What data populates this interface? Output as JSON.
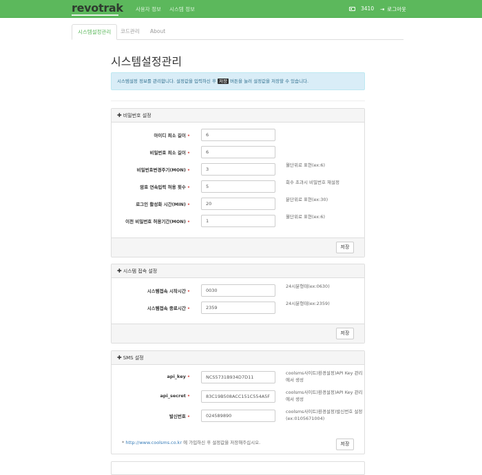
{
  "navbar": {
    "brand": "revotrak",
    "links": [
      "사용자 정보",
      "시스템 정보"
    ],
    "credits": "3410",
    "logout": "로그아웃"
  },
  "tabs": [
    "시스템설정관리",
    "코드관리",
    "About"
  ],
  "page": {
    "title": "시스템설정관리",
    "info_before": "시스템설정 정보를 관리합니다. 설정값을 입력하신 후 ",
    "info_key": "저장",
    "info_after": " 버튼을 눌러 설정값을 저장할 수 있습니다."
  },
  "password_panel": {
    "heading": "비밀번호 설정",
    "fields": [
      {
        "label": "아이디 최소 길이",
        "value": "6",
        "help": ""
      },
      {
        "label": "비밀번호 최소 길이",
        "value": "6",
        "help": ""
      },
      {
        "label": "비밀번호변경주기(MON)",
        "value": "3",
        "help": "월단위로 표현(ex:6)"
      },
      {
        "label": "암호 연속입력 허용 횟수",
        "value": "5",
        "help": "회수 초과시 비밀번호 재설정"
      },
      {
        "label": "로그인 활성화 시간(MIN)",
        "value": "20",
        "help": "분단위로 표현(ex:30)"
      },
      {
        "label": "이전 비밀번호 허용기간(MON)",
        "value": "1",
        "help": "월단위로 표현(ex:6)"
      }
    ],
    "save": "저장"
  },
  "access_panel": {
    "heading": "시스템 접속 설정",
    "fields": [
      {
        "label": "시스템접속 시작시간",
        "value": "0030",
        "help": "24시분형태(ex:0630)"
      },
      {
        "label": "시스템접속 종료시간",
        "value": "2359",
        "help": "24시분형태(ex:2359)"
      }
    ],
    "save": "저장"
  },
  "sms_panel": {
    "heading": "SMS 설정",
    "fields": [
      {
        "label": "api_key",
        "value": "NCS5731B934D7D11",
        "help": "coolsms사이트)환경설정)API Key 관리에서 생성"
      },
      {
        "label": "api_secret",
        "value": "83C19B508ACC151C554A5F",
        "help": "coolsms사이트)환경설정)API Key 관리에서 생성"
      },
      {
        "label": "발신번호",
        "value": "024589890",
        "help": "coolsms사이트)환경설정)발신번호 설정(ex:0105671004)"
      }
    ],
    "note_prefix": "* ",
    "note_link": "http://www.coolsms.co.kr",
    "note_suffix": " 에 가입하신 후 설정값을 저장해주십시오.",
    "save": "저장"
  }
}
